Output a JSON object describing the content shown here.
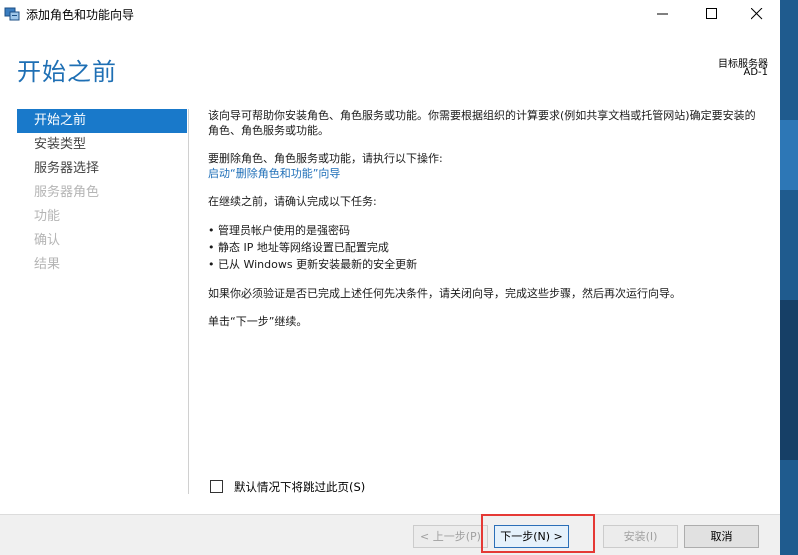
{
  "window": {
    "title": "添加角色和功能向导",
    "icon": "server-manager-icon"
  },
  "header": {
    "page_title": "开始之前",
    "destination_label": "目标服务器",
    "destination_name": "AD-1"
  },
  "nav": {
    "items": [
      {
        "label": "开始之前",
        "state": "active"
      },
      {
        "label": "安装类型",
        "state": "enabled"
      },
      {
        "label": "服务器选择",
        "state": "enabled"
      },
      {
        "label": "服务器角色",
        "state": "disabled"
      },
      {
        "label": "功能",
        "state": "disabled"
      },
      {
        "label": "确认",
        "state": "disabled"
      },
      {
        "label": "结果",
        "state": "disabled"
      }
    ]
  },
  "content": {
    "intro": "该向导可帮助你安装角色、角色服务或功能。你需要根据组织的计算要求(例如共享文档或托管网站)确定要安装的角色、角色服务或功能。",
    "remove_instruction": "要删除角色、角色服务或功能，请执行以下操作:",
    "remove_link": "启动“删除角色和功能”向导",
    "before_continue": "在继续之前，请确认完成以下任务:",
    "tasks": [
      "• 管理员帐户使用的是强密码",
      "• 静态 IP 地址等网络设置已配置完成",
      "• 已从 Windows 更新安装最新的安全更新"
    ],
    "prereq_note": "如果你必须验证是否已完成上述任何先决条件，请关闭向导，完成这些步骤，然后再次运行向导。",
    "click_next": "单击“下一步”继续。"
  },
  "skip_checkbox": {
    "label": "默认情况下将跳过此页(S)",
    "checked": false
  },
  "footer": {
    "prev_label": "< 上一步(P)",
    "next_label": "下一步(N) >",
    "install_label": "安装(I)",
    "cancel_label": "取消"
  },
  "colors": {
    "accent": "#1979ca",
    "title_blue": "#1e6fb4",
    "link": "#1f6fb8",
    "highlight": "#e53935"
  }
}
